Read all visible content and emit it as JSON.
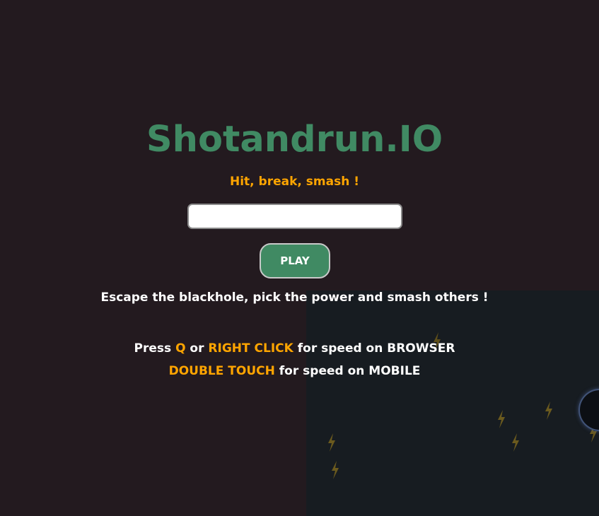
{
  "game": {
    "title": "Shotandrun.IO",
    "subtitle": "Hit, break, smash !",
    "name_input": {
      "value": "",
      "placeholder": ""
    },
    "play_button_label": "PLAY",
    "tagline": "Escape the blackhole, pick the power and smash others !",
    "help": {
      "line1": {
        "prefix": "Press ",
        "key1": "Q",
        "middle": " or ",
        "key2": "RIGHT CLICK",
        "suffix": " for speed on BROWSER"
      },
      "line2": {
        "key": "DOUBLE TOUCH",
        "suffix": " for speed on MOBILE"
      }
    },
    "field": {
      "powerup_icon": "lightning-bolt-icon",
      "hazard": "blackhole"
    }
  },
  "colors": {
    "background": "#231a1f",
    "field": "#171c21",
    "title_green": "#408a63",
    "accent_orange": "#ffa500",
    "text_white": "#ffffff",
    "bolt": "#6b5a1e"
  }
}
